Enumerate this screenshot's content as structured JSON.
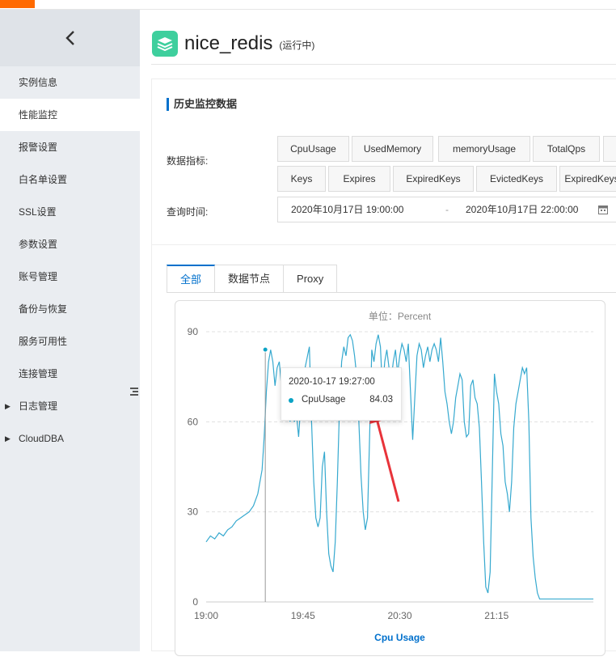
{
  "sidebar": {
    "back_icon": "chevron-left-icon",
    "items": [
      {
        "label": "实例信息",
        "active": false
      },
      {
        "label": "性能监控",
        "active": true
      },
      {
        "label": "报警设置",
        "active": false
      },
      {
        "label": "白名单设置",
        "active": false
      },
      {
        "label": "SSL设置",
        "active": false
      },
      {
        "label": "参数设置",
        "active": false
      },
      {
        "label": "账号管理",
        "active": false
      },
      {
        "label": "备份与恢复",
        "active": false
      },
      {
        "label": "服务可用性",
        "active": false
      },
      {
        "label": "连接管理",
        "active": false
      },
      {
        "label": "日志管理",
        "active": false,
        "expandable": true
      },
      {
        "label": "CloudDBA",
        "active": false,
        "expandable": true
      }
    ]
  },
  "header": {
    "title": "nice_redis",
    "status": "(运行中)",
    "logo_color": "#3ecf9d"
  },
  "section": {
    "title": "历史监控数据",
    "metrics_label": "数据指标:",
    "time_label": "查询时间:",
    "metrics_row1": [
      "CpuUsage",
      "UsedMemory",
      "memoryUsage",
      "TotalQps"
    ],
    "metrics_row2": [
      "Keys",
      "Expires",
      "ExpiredKeys",
      "EvictedKeys",
      "ExpiredKeys"
    ],
    "range_start": "2020年10月17日 19:00:00",
    "range_sep": "-",
    "range_end": "2020年10月17日 22:00:00"
  },
  "tabs": [
    "全部",
    "数据节点",
    "Proxy"
  ],
  "accent_color": "#0070cc",
  "chart_data": {
    "type": "line",
    "title": "单位：Percent",
    "xlabel": "Cpu Usage",
    "ylabel": "",
    "ylim": [
      0,
      90
    ],
    "yticks": [
      0,
      30,
      60,
      90
    ],
    "xticks": [
      "19:00",
      "19:45",
      "20:30",
      "21:15"
    ],
    "x_unit": "minutes after 19:00",
    "series": [
      {
        "name": "CpuUsage",
        "color": "#36a9cf",
        "points": [
          [
            0,
            20
          ],
          [
            2,
            22
          ],
          [
            4,
            21
          ],
          [
            6,
            23
          ],
          [
            8,
            22
          ],
          [
            10,
            24
          ],
          [
            12,
            25
          ],
          [
            14,
            27
          ],
          [
            16,
            28
          ],
          [
            18,
            29
          ],
          [
            20,
            30
          ],
          [
            22,
            32
          ],
          [
            24,
            36
          ],
          [
            26,
            44
          ],
          [
            27,
            55
          ],
          [
            28,
            70
          ],
          [
            29,
            80
          ],
          [
            30,
            84
          ],
          [
            31,
            80
          ],
          [
            32,
            72
          ],
          [
            33,
            78
          ],
          [
            34,
            80
          ],
          [
            35,
            72
          ],
          [
            36,
            75
          ],
          [
            37,
            66
          ],
          [
            38,
            70
          ],
          [
            39,
            60
          ],
          [
            40,
            65
          ],
          [
            41,
            60
          ],
          [
            42,
            62
          ],
          [
            43,
            55
          ],
          [
            44,
            66
          ],
          [
            46,
            78
          ],
          [
            48,
            85
          ],
          [
            49,
            60
          ],
          [
            50,
            40
          ],
          [
            51,
            28
          ],
          [
            52,
            25
          ],
          [
            53,
            28
          ],
          [
            54,
            45
          ],
          [
            55,
            50
          ],
          [
            56,
            30
          ],
          [
            57,
            16
          ],
          [
            58,
            12
          ],
          [
            59,
            10
          ],
          [
            60,
            20
          ],
          [
            61,
            40
          ],
          [
            62,
            65
          ],
          [
            63,
            80
          ],
          [
            64,
            85
          ],
          [
            65,
            82
          ],
          [
            66,
            88
          ],
          [
            67,
            89
          ],
          [
            68,
            87
          ],
          [
            69,
            82
          ],
          [
            70,
            75
          ],
          [
            71,
            60
          ],
          [
            72,
            42
          ],
          [
            73,
            30
          ],
          [
            74,
            24
          ],
          [
            75,
            28
          ],
          [
            76,
            55
          ],
          [
            77,
            84
          ],
          [
            78,
            80
          ],
          [
            79,
            86
          ],
          [
            80,
            89
          ],
          [
            81,
            85
          ],
          [
            82,
            70
          ],
          [
            83,
            80
          ],
          [
            84,
            84
          ],
          [
            85,
            78
          ],
          [
            86,
            74
          ],
          [
            87,
            80
          ],
          [
            88,
            84
          ],
          [
            89,
            76
          ],
          [
            90,
            82
          ],
          [
            91,
            86
          ],
          [
            92,
            84
          ],
          [
            93,
            80
          ],
          [
            94,
            86
          ],
          [
            95,
            70
          ],
          [
            96,
            54
          ],
          [
            97,
            68
          ],
          [
            98,
            82
          ],
          [
            99,
            86
          ],
          [
            100,
            84
          ],
          [
            101,
            78
          ],
          [
            102,
            82
          ],
          [
            103,
            85
          ],
          [
            104,
            80
          ],
          [
            105,
            84
          ],
          [
            106,
            86
          ],
          [
            107,
            84
          ],
          [
            108,
            80
          ],
          [
            109,
            88
          ],
          [
            110,
            80
          ],
          [
            111,
            70
          ],
          [
            112,
            66
          ],
          [
            113,
            60
          ],
          [
            114,
            56
          ],
          [
            115,
            60
          ],
          [
            116,
            68
          ],
          [
            117,
            72
          ],
          [
            118,
            76
          ],
          [
            119,
            74
          ],
          [
            120,
            60
          ],
          [
            121,
            55
          ],
          [
            122,
            56
          ],
          [
            123,
            72
          ],
          [
            124,
            74
          ],
          [
            125,
            68
          ],
          [
            126,
            66
          ],
          [
            127,
            58
          ],
          [
            128,
            40
          ],
          [
            129,
            20
          ],
          [
            130,
            5
          ],
          [
            131,
            3
          ],
          [
            132,
            10
          ],
          [
            133,
            42
          ],
          [
            134,
            76
          ],
          [
            135,
            70
          ],
          [
            136,
            66
          ],
          [
            137,
            56
          ],
          [
            138,
            52
          ],
          [
            139,
            40
          ],
          [
            140,
            36
          ],
          [
            141,
            30
          ],
          [
            142,
            40
          ],
          [
            143,
            58
          ],
          [
            144,
            66
          ],
          [
            145,
            70
          ],
          [
            146,
            74
          ],
          [
            147,
            78
          ],
          [
            148,
            76
          ],
          [
            149,
            78
          ],
          [
            150,
            60
          ],
          [
            151,
            28
          ],
          [
            152,
            15
          ],
          [
            153,
            8
          ],
          [
            154,
            3
          ],
          [
            155,
            1
          ],
          [
            160,
            1
          ],
          [
            170,
            1
          ],
          [
            180,
            1
          ]
        ]
      }
    ],
    "tooltip": {
      "time": "2020-10-17 19:27:00",
      "series": "CpuUsage",
      "value": "84.03",
      "x": 27.5
    }
  }
}
